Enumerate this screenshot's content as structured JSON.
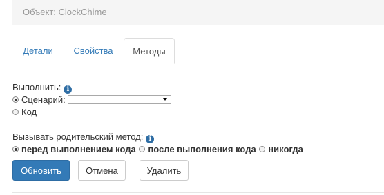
{
  "object_bar": {
    "text": "Объект: ClockChime"
  },
  "tabs": [
    {
      "label": "Детали",
      "active": false
    },
    {
      "label": "Свойства",
      "active": false
    },
    {
      "label": "Методы",
      "active": true
    }
  ],
  "execute": {
    "label": "Выполнить:",
    "info_icon": "info-icon",
    "options": [
      {
        "label": "Сценарий:",
        "checked": true
      },
      {
        "label": "Код",
        "checked": false
      }
    ],
    "script_select_value": ""
  },
  "parent_method": {
    "label": "Вызывать родительский метод:",
    "info_icon": "info-icon",
    "options": [
      {
        "label": "перед выполнением кода",
        "checked": true
      },
      {
        "label": "после выполнения кода",
        "checked": false
      },
      {
        "label": "никогда",
        "checked": false
      }
    ]
  },
  "buttons": {
    "update": "Обновить",
    "cancel": "Отмена",
    "delete": "Удалить"
  },
  "colors": {
    "primary": "#337ab7",
    "link": "#337ab7",
    "info": "#2e6da4"
  }
}
